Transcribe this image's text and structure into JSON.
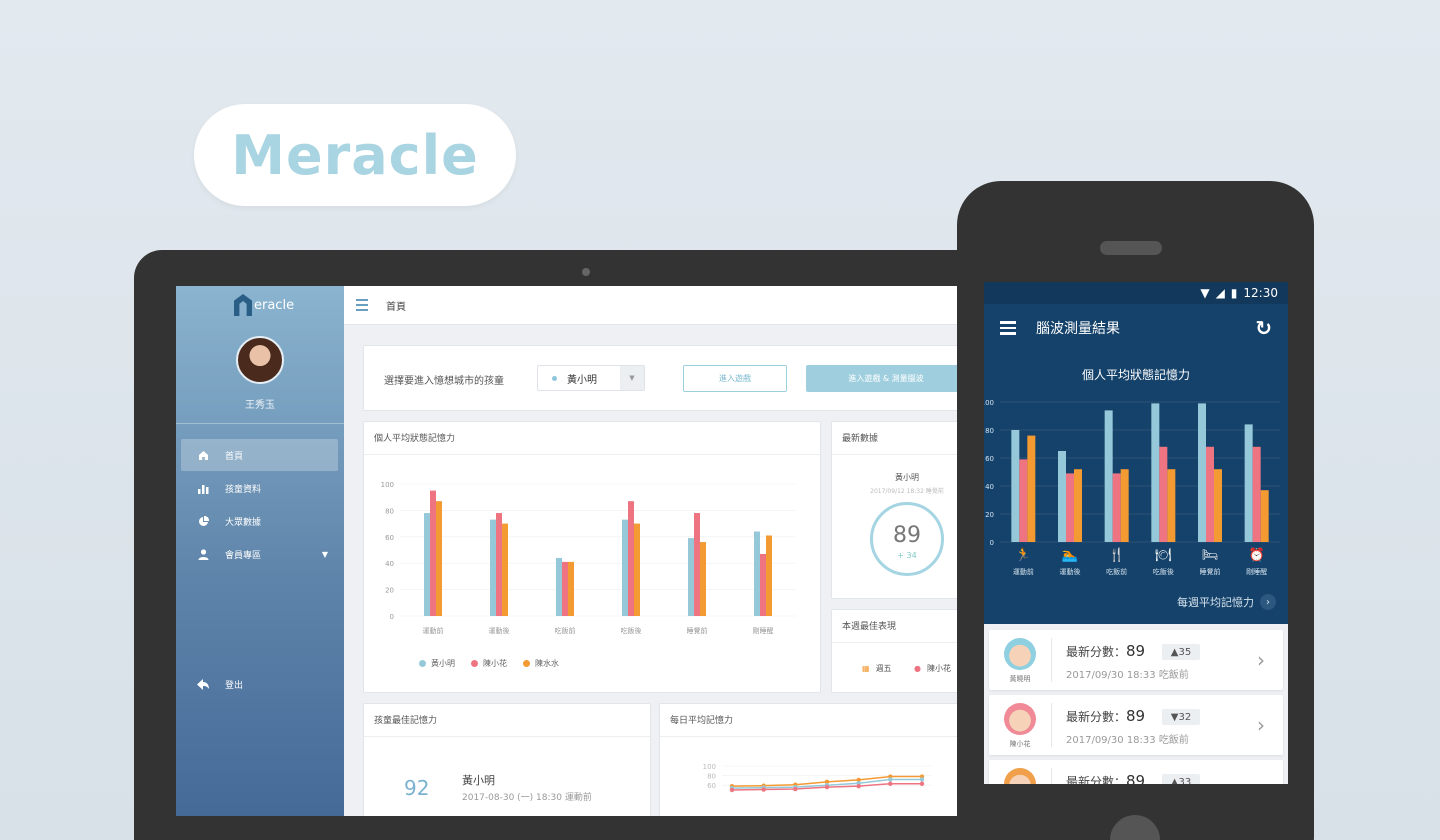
{
  "brand": {
    "name": "Meracle"
  },
  "tablet": {
    "logo_text": "eracle",
    "user_name": "王秀玉",
    "nav": [
      {
        "label": "首頁",
        "icon": "home-icon",
        "active": true
      },
      {
        "label": "孩童資料",
        "icon": "bar-chart-icon",
        "active": false
      },
      {
        "label": "大眾數據",
        "icon": "pie-chart-icon",
        "active": false
      },
      {
        "label": "會員專區",
        "icon": "user-icon",
        "active": false
      }
    ],
    "logout_label": "登出",
    "breadcrumb": "首頁",
    "select_label": "選擇要進入憶想城市的孩童",
    "select_value": "黃小明",
    "btn_enter": "進入遊戲",
    "btn_enter_measure": "進入遊戲 & 測量腦波",
    "personal_title": "個人平均狀態記憶力",
    "latest_title": "最新數據",
    "latest_name": "黃小明",
    "latest_time": "2017/09/12 18:32 睡覺前",
    "latest_score": "89",
    "latest_delta": "+ 34",
    "best_week_title": "本週最佳表現",
    "best_week_day": "週五",
    "best_week_child": "陳小花",
    "child_best_title": "孩童最佳記憶力",
    "child_best_score": "92",
    "child_best_name": "黃小明",
    "child_best_time": "2017-08-30 (一) 18:30  運動前",
    "daily_title": "每日平均記憶力"
  },
  "phone": {
    "time": "12:30",
    "title": "腦波測量結果",
    "chart_title": "個人平均狀態記憶力",
    "weekly_link": "每週平均記憶力",
    "records": [
      {
        "name": "黃曉明",
        "score_label": "最新分數：",
        "score": "89",
        "delta": "▲35",
        "time": "2017/09/30 18:33  吃飯前",
        "face_color": "#8ecfe0"
      },
      {
        "name": "陳小花",
        "score_label": "最新分數：",
        "score": "89",
        "delta": "▼32",
        "time": "2017/09/30 18:33  吃飯前",
        "face_color": "#f08a96"
      },
      {
        "name": "",
        "score_label": "最新分數：",
        "score": "89",
        "delta": "▲33",
        "time": "",
        "face_color": "#f0a04b"
      }
    ]
  },
  "chart_data": [
    {
      "type": "bar",
      "title": "個人平均狀態記憶力",
      "categories": [
        "運動前",
        "運動後",
        "吃飯前",
        "吃飯後",
        "睡覺前",
        "剛睡醒"
      ],
      "ylim": [
        0,
        100
      ],
      "yticks": [
        0,
        20,
        40,
        60,
        80,
        100
      ],
      "legend_position": "bottom",
      "series": [
        {
          "name": "黃小明",
          "color": "#95c9da",
          "values": [
            78,
            73,
            44,
            73,
            59,
            64
          ]
        },
        {
          "name": "陳小花",
          "color": "#ef7482",
          "values": [
            95,
            78,
            41,
            87,
            78,
            47
          ]
        },
        {
          "name": "陳水水",
          "color": "#f39a33",
          "values": [
            87,
            70,
            41,
            70,
            56,
            61
          ]
        }
      ]
    },
    {
      "type": "bar",
      "title": "個人平均狀態記憶力",
      "categories": [
        "運動前",
        "運動後",
        "吃飯前",
        "吃飯後",
        "睡覺前",
        "剛睡醒"
      ],
      "ylim": [
        0,
        100
      ],
      "yticks": [
        0,
        20,
        40,
        60,
        80,
        100
      ],
      "series": [
        {
          "color": "#95c9da",
          "values": [
            80,
            65,
            94,
            99,
            99,
            84
          ]
        },
        {
          "color": "#ef7482",
          "values": [
            59,
            49,
            49,
            68,
            68,
            68
          ]
        },
        {
          "color": "#f39a33",
          "values": [
            76,
            52,
            52,
            52,
            52,
            37
          ]
        }
      ]
    },
    {
      "type": "line",
      "title": "每日平均記憶力",
      "ylim": [
        0,
        100
      ],
      "yticks": [
        60,
        80,
        100
      ],
      "series": [
        {
          "color": "#f39a33",
          "values": [
            58,
            59,
            61,
            67,
            71,
            78,
            78
          ]
        },
        {
          "color": "#95c9da",
          "values": [
            54,
            55,
            56,
            60,
            64,
            72,
            72
          ]
        },
        {
          "color": "#ef7482",
          "values": [
            50,
            51,
            52,
            56,
            58,
            63,
            63
          ]
        }
      ]
    }
  ]
}
